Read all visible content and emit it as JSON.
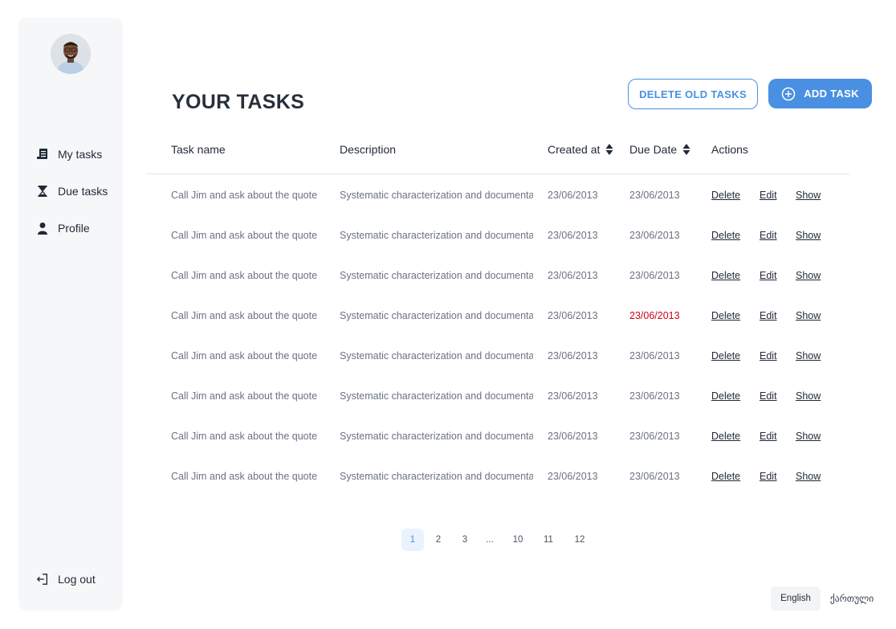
{
  "sidebar": {
    "items": [
      {
        "label": "My tasks",
        "icon": "document-list-icon"
      },
      {
        "label": "Due tasks",
        "icon": "hourglass-icon"
      },
      {
        "label": "Profile",
        "icon": "user-icon"
      }
    ],
    "logout_label": "Log out"
  },
  "page": {
    "title": "YOUR TASKS"
  },
  "toolbar": {
    "delete_old_label": "DELETE OLD TASKS",
    "add_label": "ADD TASK"
  },
  "table": {
    "columns": [
      "Task name",
      "Description",
      "Created at",
      "Due Date",
      "Actions"
    ],
    "rows": [
      {
        "name": "Call Jim and ask about the quote",
        "description": "Systematic characterization and documenta",
        "created": "23/06/2013",
        "due": "23/06/2013",
        "overdue": false
      },
      {
        "name": "Call Jim and ask about the quote",
        "description": "Systematic characterization and documenta",
        "created": "23/06/2013",
        "due": "23/06/2013",
        "overdue": false
      },
      {
        "name": "Call Jim and ask about the quote",
        "description": "Systematic characterization and documenta",
        "created": "23/06/2013",
        "due": "23/06/2013",
        "overdue": false
      },
      {
        "name": "Call Jim and ask about the quote",
        "description": "Systematic characterization and documenta",
        "created": "23/06/2013",
        "due": "23/06/2013",
        "overdue": true
      },
      {
        "name": "Call Jim and ask about the quote",
        "description": "Systematic characterization and documenta",
        "created": "23/06/2013",
        "due": "23/06/2013",
        "overdue": false
      },
      {
        "name": "Call Jim and ask about the quote",
        "description": "Systematic characterization and documenta",
        "created": "23/06/2013",
        "due": "23/06/2013",
        "overdue": false
      },
      {
        "name": "Call Jim and ask about the quote",
        "description": "Systematic characterization and documenta",
        "created": "23/06/2013",
        "due": "23/06/2013",
        "overdue": false
      },
      {
        "name": "Call Jim and ask about the quote",
        "description": "Systematic characterization and documenta",
        "created": "23/06/2013",
        "due": "23/06/2013",
        "overdue": false
      }
    ],
    "actions": {
      "delete": "Delete",
      "edit": "Edit",
      "show": "Show"
    }
  },
  "pagination": {
    "pages": [
      "1",
      "2",
      "3",
      "...",
      "10",
      "11",
      "12"
    ],
    "active": "1"
  },
  "language": {
    "english": "English",
    "georgian": "ქართული",
    "selected": "English"
  },
  "colors": {
    "accent": "#4a90e2",
    "overdue": "#d0021b",
    "sidebar_bg": "#f6f7f9"
  }
}
